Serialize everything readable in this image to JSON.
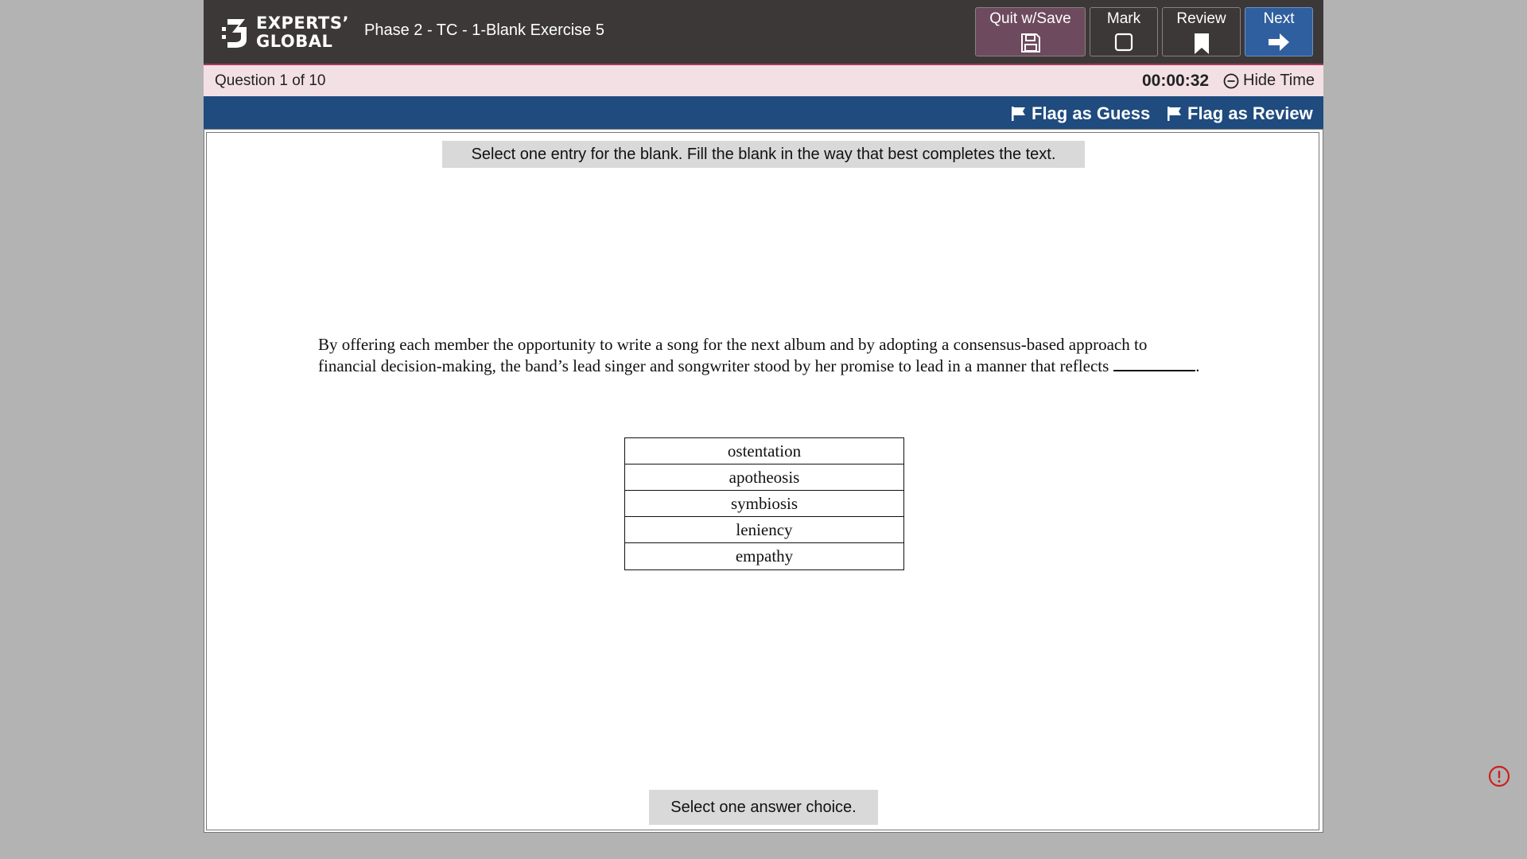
{
  "header": {
    "logo_line1": "EXPERTS’",
    "logo_line2": "GLOBAL",
    "exam_title": "Phase 2 - TC - 1-Blank Exercise 5",
    "buttons": {
      "quit": "Quit w/Save",
      "mark": "Mark",
      "review": "Review",
      "next": "Next"
    }
  },
  "question_bar": {
    "question_label": "Question",
    "question_number": "1",
    "of_label": "of",
    "total": "10",
    "timer": "00:00:32",
    "hide_time": "Hide Time"
  },
  "flag_bar": {
    "flag_guess": "Flag as Guess",
    "flag_review": "Flag as Review"
  },
  "question": {
    "directions": "Select one entry for the blank. Fill the blank in the way that best completes the text.",
    "passage_before": "By offering each member the opportunity to write a song for the next album and by adopting a consensus-based approach to financial decision-making, the band’s lead singer and songwriter stood by her promise to lead in a manner that reflects",
    "passage_after": ".",
    "choices": [
      "ostentation",
      "apotheosis",
      "symbiosis",
      "leniency",
      "empathy"
    ],
    "status": "Select one answer choice."
  },
  "colors": {
    "topbar": "#3c3838",
    "quit_button": "#6d4a5d",
    "next_button": "#2f5f9e",
    "question_bar": "#f2e0e5",
    "flag_bar": "#1f4b7f",
    "alert": "#cc1f1f"
  },
  "icons": {
    "quit": "floppy-disk-icon",
    "mark": "checkbox-icon",
    "review": "bookmark-icon",
    "next": "arrow-right-icon",
    "hide_time": "minus-circle-icon",
    "flag": "flag-icon",
    "alert": "exclamation-circle-icon"
  }
}
